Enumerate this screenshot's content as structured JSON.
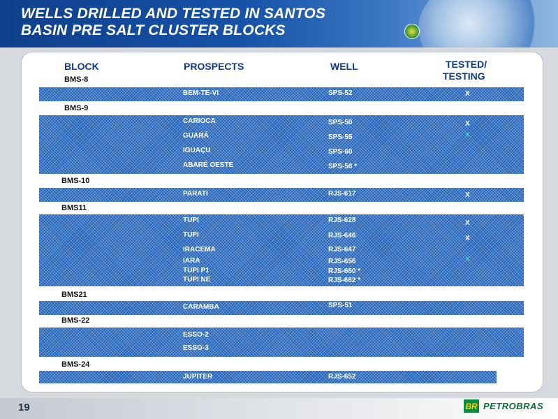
{
  "slide": {
    "title_lines": [
      "WELLS DRILLED AND TESTED IN SANTOS",
      "BASIN PRE SALT CLUSTER BLOCKS"
    ],
    "page_number": "19",
    "logo_mark": "BR",
    "logo_text": "PETROBRAS"
  },
  "table": {
    "headers": {
      "block": "BLOCK",
      "prospects": "PROSPECTS",
      "well": "WELL",
      "tested_line1": "TESTED/",
      "tested_line2": "TESTING"
    },
    "blocks": [
      {
        "label": "BMS-8",
        "rows": [
          {
            "prospect": "BEM-TE-VI",
            "well": "SPS-52",
            "tested": "X"
          }
        ]
      },
      {
        "label": "BMS-9",
        "rows": [
          {
            "prospect": "CARIOCA",
            "well": "SPS-50",
            "tested": "X"
          },
          {
            "prospect": "GUARÁ",
            "well": "SPS-55",
            "tested": "X"
          },
          {
            "prospect": "IGUAÇU",
            "well": "SPS-60",
            "tested": ""
          },
          {
            "prospect": "ABARÉ OESTE",
            "well": "SPS-56 *",
            "tested": ""
          }
        ]
      },
      {
        "label": "BMS-10",
        "rows": [
          {
            "prospect": "PARATI",
            "well": "RJS-617",
            "tested": "X"
          }
        ]
      },
      {
        "label": "BMS11",
        "rows": [
          {
            "prospect": "TUPI",
            "well": "RJS-628",
            "tested": "X"
          },
          {
            "prospect": "TUPI",
            "well": "RJS-646",
            "tested": "X"
          },
          {
            "prospect": "IRACEMA",
            "well": "RJS-647",
            "tested": ""
          },
          {
            "prospect": "IARA",
            "well": "RJS-656",
            "tested": "X"
          },
          {
            "prospect": "TUPI P1",
            "well": "RJS-660 *",
            "tested": ""
          },
          {
            "prospect": "TUPI NE",
            "well": "RJS-662 *",
            "tested": ""
          }
        ]
      },
      {
        "label": "BMS21",
        "rows": [
          {
            "prospect": "CARAMBA",
            "well": "SPS-51",
            "tested": ""
          }
        ]
      },
      {
        "label": "BMS-22",
        "rows": [
          {
            "prospect": "ESSO-2",
            "well": "",
            "tested": ""
          },
          {
            "prospect": "ESSO-3",
            "well": "",
            "tested": ""
          }
        ]
      },
      {
        "label": "BMS-24",
        "rows": [
          {
            "prospect": "JUPITER",
            "well": "RJS-652",
            "tested": ""
          }
        ]
      }
    ]
  },
  "colors": {
    "header_blue": "#1753a7",
    "band_blue": "#1d5fb6",
    "teal_mark": "#46d4c8",
    "petrobras_green": "#0a8a3c",
    "petrobras_yellow": "#f6d40b"
  }
}
